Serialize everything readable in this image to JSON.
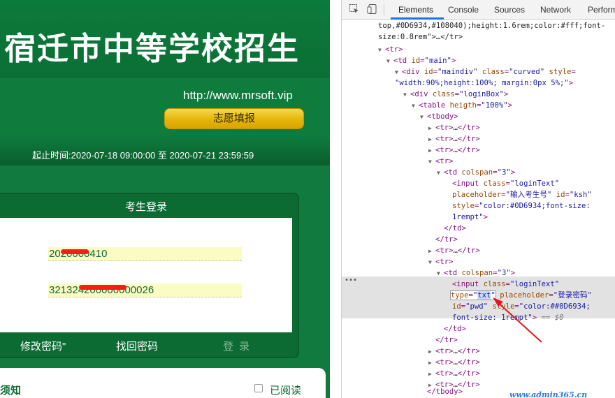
{
  "page": {
    "banner_title": "宿迁市中等学校招生",
    "site_url": "http://www.mrsoft.vip",
    "fill_button": "志愿填报",
    "time_range": "起止时间:2020-07-18 09:00:00 至 2020-07-21 23:59:59",
    "login": {
      "header": "考生登录",
      "exam_id_value": "2020000410",
      "exam_id_placeholder": "输入考生号",
      "password_value": "321324200000000026",
      "password_placeholder": "登录密码",
      "change_password": "修改密码\"",
      "find_password": "找回密码",
      "login_button": "登 录"
    },
    "notice": {
      "title": "须知",
      "read_label": "已阅读"
    }
  },
  "devtools": {
    "tabs": [
      "Elements",
      "Console",
      "Sources",
      "Network",
      "Performance"
    ],
    "dom_lines": [
      {
        "text1": "top,#0D6934,#108040);height:1.6rem;color:#fff;font-",
        "indent": 52
      },
      {
        "text1": "size:0.8rem\">…</tr>",
        "indent": 52
      }
    ],
    "watermark": "www.admin365.cn"
  },
  "colors": {
    "page_green": "#117a3f",
    "login_green": "#0b6b33",
    "input_bg": "#fbfbc4",
    "button_gold": "#e5b50c",
    "highlight": "#e2e2e2"
  }
}
